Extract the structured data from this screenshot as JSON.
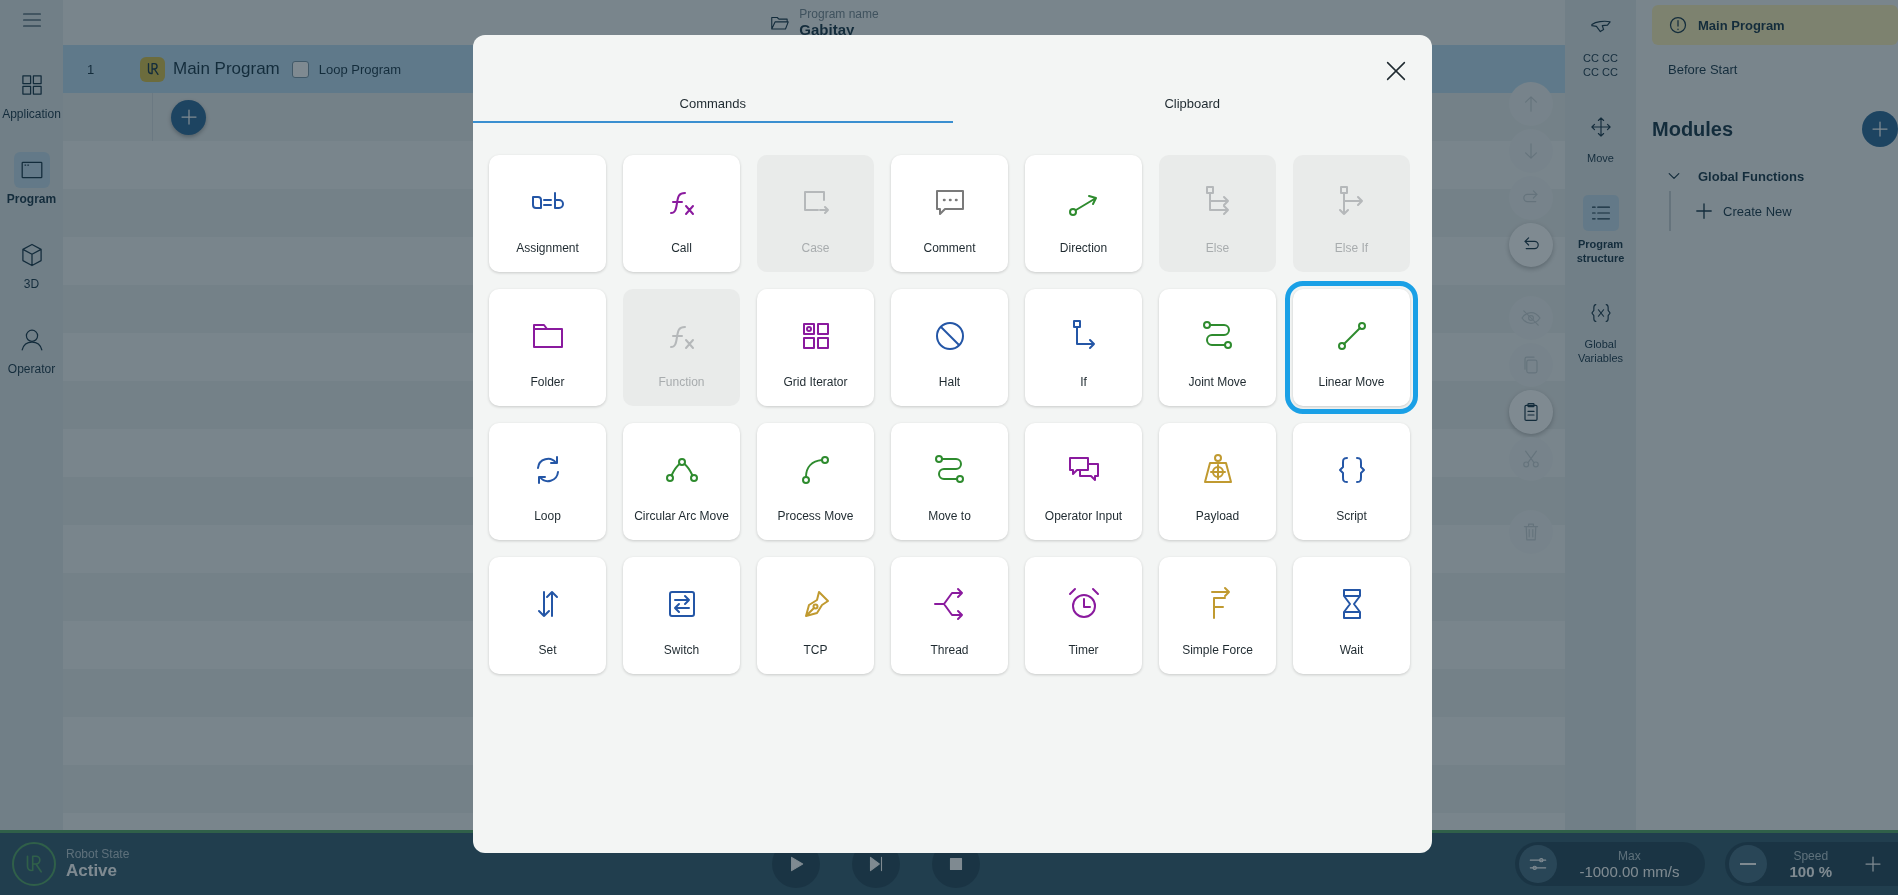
{
  "sidebar": {
    "items": [
      {
        "label": "Application",
        "kind": "application",
        "selected": false
      },
      {
        "label": "Program",
        "kind": "program",
        "selected": true
      },
      {
        "label": "3D",
        "kind": "cube",
        "selected": false
      },
      {
        "label": "Operator",
        "kind": "operator",
        "selected": false
      }
    ]
  },
  "header": {
    "label": "Program name",
    "value": "Gabitay"
  },
  "program": {
    "rows": [
      {
        "line": "1",
        "title": "Main Program",
        "loop_label": "Loop Program",
        "loop_checked": false
      }
    ]
  },
  "edit_tools": [
    {
      "kind": "up",
      "disabled": true
    },
    {
      "kind": "down",
      "disabled": true
    },
    {
      "kind": "redo",
      "disabled": true
    },
    {
      "kind": "undo",
      "disabled": false
    },
    {
      "kind": "hide",
      "disabled": true
    },
    {
      "kind": "copy",
      "disabled": true
    },
    {
      "kind": "paste",
      "disabled": false
    },
    {
      "kind": "cut",
      "disabled": true
    },
    {
      "kind": "delete",
      "disabled": true
    }
  ],
  "right_toolbar": {
    "items": [
      {
        "label": "CC CC CC CC",
        "kind": "gripper",
        "selected": false
      },
      {
        "label": "Move",
        "kind": "move",
        "selected": false
      },
      {
        "label": "Program structure",
        "kind": "structure",
        "selected": true
      },
      {
        "label": "Global Variables",
        "kind": "variables",
        "selected": false
      }
    ]
  },
  "structure_panel": {
    "items": [
      {
        "label": "Main Program",
        "selected": true,
        "warning": true
      },
      {
        "label": "Before Start",
        "selected": false,
        "warning": false
      }
    ],
    "modules_title": "Modules",
    "groups": [
      {
        "label": "Global Functions",
        "expanded": true,
        "children": [
          {
            "label": "Create New"
          }
        ]
      }
    ]
  },
  "dialog": {
    "tabs": [
      {
        "label": "Commands",
        "selected": true
      },
      {
        "label": "Clipboard",
        "selected": false
      }
    ],
    "commands": [
      {
        "label": "Assignment",
        "kind": "assignment",
        "color": "#2456a6",
        "disabled": false,
        "selected": false
      },
      {
        "label": "Call",
        "kind": "call",
        "color": "#8a1a9e",
        "disabled": false,
        "selected": false
      },
      {
        "label": "Case",
        "kind": "case",
        "disabled": true,
        "selected": false
      },
      {
        "label": "Comment",
        "kind": "comment",
        "color": "#7a7a7a",
        "disabled": false,
        "selected": false
      },
      {
        "label": "Direction",
        "kind": "direction",
        "color": "#2e8b2e",
        "disabled": false,
        "selected": false
      },
      {
        "label": "Else",
        "kind": "else",
        "disabled": true,
        "selected": false
      },
      {
        "label": "Else If",
        "kind": "else_if",
        "disabled": true,
        "selected": false
      },
      {
        "label": "Folder",
        "kind": "folder",
        "color": "#8a1a9e",
        "disabled": false,
        "selected": false
      },
      {
        "label": "Function",
        "kind": "function",
        "disabled": true,
        "selected": false
      },
      {
        "label": "Grid Iterator",
        "kind": "grid_iterator",
        "color": "#8a1a9e",
        "disabled": false,
        "selected": false
      },
      {
        "label": "Halt",
        "kind": "halt",
        "color": "#2456a6",
        "disabled": false,
        "selected": false
      },
      {
        "label": "If",
        "kind": "if",
        "color": "#2456a6",
        "disabled": false,
        "selected": false
      },
      {
        "label": "Joint Move",
        "kind": "joint_move",
        "color": "#2e8b2e",
        "disabled": false,
        "selected": false
      },
      {
        "label": "Linear Move",
        "kind": "linear_move",
        "color": "#2e8b2e",
        "disabled": false,
        "selected": true
      },
      {
        "label": "Loop",
        "kind": "loop",
        "color": "#2456a6",
        "disabled": false,
        "selected": false
      },
      {
        "label": "Circular Arc Move",
        "kind": "circular_arc",
        "color": "#2e8b2e",
        "disabled": false,
        "selected": false
      },
      {
        "label": "Process Move",
        "kind": "process_move",
        "color": "#2e8b2e",
        "disabled": false,
        "selected": false
      },
      {
        "label": "Move to",
        "kind": "move_to",
        "color": "#2e8b2e",
        "disabled": false,
        "selected": false
      },
      {
        "label": "Operator Input",
        "kind": "operator_input",
        "color": "#8a1a9e",
        "disabled": false,
        "selected": false
      },
      {
        "label": "Payload",
        "kind": "payload",
        "color": "#c09a30",
        "disabled": false,
        "selected": false
      },
      {
        "label": "Script",
        "kind": "script",
        "color": "#2456a6",
        "disabled": false,
        "selected": false
      },
      {
        "label": "Set",
        "kind": "set",
        "color": "#2456a6",
        "disabled": false,
        "selected": false
      },
      {
        "label": "Switch",
        "kind": "switch",
        "color": "#2456a6",
        "disabled": false,
        "selected": false
      },
      {
        "label": "TCP",
        "kind": "tcp",
        "color": "#c09a30",
        "disabled": false,
        "selected": false
      },
      {
        "label": "Thread",
        "kind": "thread",
        "color": "#8a1a9e",
        "disabled": false,
        "selected": false
      },
      {
        "label": "Timer",
        "kind": "timer",
        "color": "#8a1a9e",
        "disabled": false,
        "selected": false
      },
      {
        "label": "Simple Force",
        "kind": "simple_force",
        "color": "#c09a30",
        "disabled": false,
        "selected": false
      },
      {
        "label": "Wait",
        "kind": "wait",
        "color": "#2456a6",
        "disabled": false,
        "selected": false
      }
    ]
  },
  "status_bar": {
    "robot_state_label": "Robot State",
    "robot_state": "Active",
    "max_label": "Max",
    "max_value": "-1000.00 mm/s",
    "speed_label": "Speed",
    "speed_value": "100 %"
  }
}
